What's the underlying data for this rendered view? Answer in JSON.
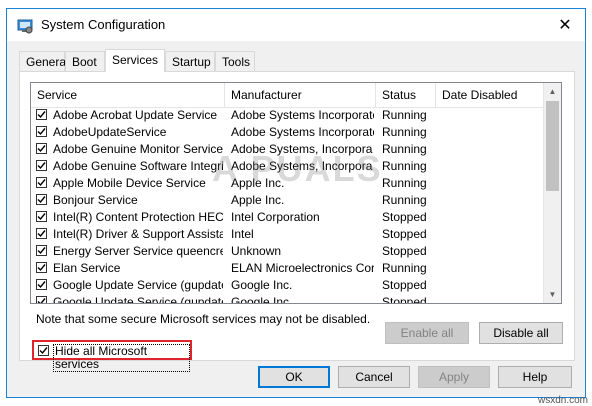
{
  "window": {
    "title": "System Configuration",
    "close_label": "✕"
  },
  "tabs": [
    {
      "label": "General",
      "active": false
    },
    {
      "label": "Boot",
      "active": false
    },
    {
      "label": "Services",
      "active": true
    },
    {
      "label": "Startup",
      "active": false
    },
    {
      "label": "Tools",
      "active": false
    }
  ],
  "columns": {
    "service": "Service",
    "manufacturer": "Manufacturer",
    "status": "Status",
    "date_disabled": "Date Disabled"
  },
  "rows": [
    {
      "service": "Adobe Acrobat Update Service",
      "manufacturer": "Adobe Systems Incorporated",
      "status": "Running",
      "date_disabled": "",
      "checked": true
    },
    {
      "service": "AdobeUpdateService",
      "manufacturer": "Adobe Systems Incorporated",
      "status": "Running",
      "date_disabled": "",
      "checked": true
    },
    {
      "service": "Adobe Genuine Monitor Service",
      "manufacturer": "Adobe Systems, Incorpora",
      "status": "Running",
      "date_disabled": "",
      "checked": true
    },
    {
      "service": "Adobe Genuine Software Integri...",
      "manufacturer": "Adobe Systems, Incorpora",
      "status": "Running",
      "date_disabled": "",
      "checked": true
    },
    {
      "service": "Apple Mobile Device Service",
      "manufacturer": "Apple Inc.",
      "status": "Running",
      "date_disabled": "",
      "checked": true
    },
    {
      "service": "Bonjour Service",
      "manufacturer": "Apple Inc.",
      "status": "Running",
      "date_disabled": "",
      "checked": true
    },
    {
      "service": "Intel(R) Content Protection HEC...",
      "manufacturer": "Intel Corporation",
      "status": "Stopped",
      "date_disabled": "",
      "checked": true
    },
    {
      "service": "Intel(R) Driver & Support Assistant",
      "manufacturer": "Intel",
      "status": "Stopped",
      "date_disabled": "",
      "checked": true
    },
    {
      "service": "Energy Server Service queencreek",
      "manufacturer": "Unknown",
      "status": "Stopped",
      "date_disabled": "",
      "checked": true
    },
    {
      "service": "Elan Service",
      "manufacturer": "ELAN Microelectronics Corp.",
      "status": "Running",
      "date_disabled": "",
      "checked": true
    },
    {
      "service": "Google Update Service (gupdate)",
      "manufacturer": "Google Inc.",
      "status": "Stopped",
      "date_disabled": "",
      "checked": true
    },
    {
      "service": "Google Update Service (gupdatem)",
      "manufacturer": "Google Inc.",
      "status": "Stopped",
      "date_disabled": "",
      "checked": true
    }
  ],
  "note": "Note that some secure Microsoft services may not be disabled.",
  "buttons": {
    "enable_all": "Enable all",
    "disable_all": "Disable all",
    "ok": "OK",
    "cancel": "Cancel",
    "apply": "Apply",
    "help": "Help"
  },
  "hide_ms": {
    "label": "Hide all Microsoft services",
    "checked": true
  },
  "watermark": "A PUALS",
  "site": "wsxdn.com",
  "colors": {
    "accent": "#0078d7",
    "highlight_box": "#e0242b",
    "window_border": "#1883d7"
  }
}
